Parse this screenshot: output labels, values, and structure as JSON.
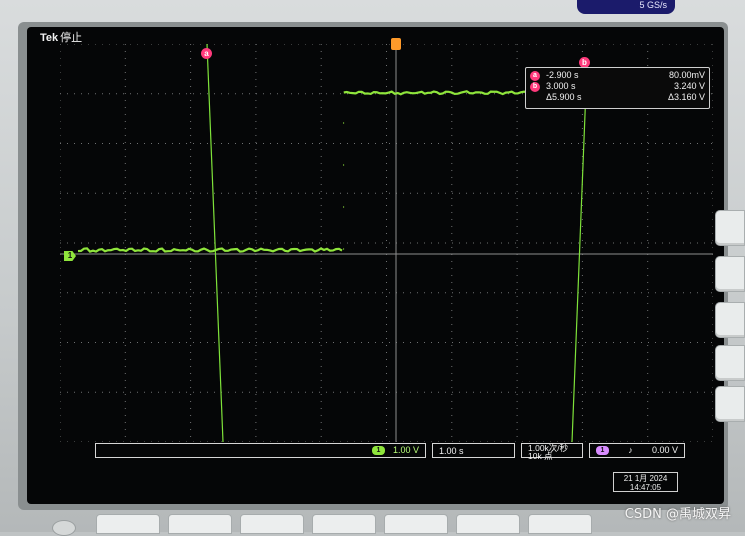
{
  "top_chip": "5 GS/s",
  "brand": {
    "name": "Tek",
    "status": "停止"
  },
  "cursor_a": {
    "label": "a",
    "time": "-2.900 s",
    "value": "80.00mV"
  },
  "cursor_b": {
    "label": "b",
    "time": "3.000 s",
    "value": "3.240 V"
  },
  "delta": {
    "time": "Δ5.900 s",
    "value": "Δ3.160 V"
  },
  "channel": {
    "number": "1",
    "scale": "1.00 V",
    "color": "#8fe53c"
  },
  "timebase": "1.00 s",
  "sample_rate": {
    "rate": "1.00k次/秒",
    "points": "10k 点"
  },
  "trigger": {
    "source": "1",
    "slope": "♪",
    "level": "0.00 V"
  },
  "date": {
    "day_month_year": "21 1月 2024",
    "time": "14:47:05"
  },
  "waveform": {
    "low_level_V": 0.08,
    "high_level_V": 3.24,
    "step_time_s": -0.8,
    "volts_per_div": 1.0,
    "seconds_per_div": 1.0
  },
  "watermark": "CSDN @禹城双昇"
}
